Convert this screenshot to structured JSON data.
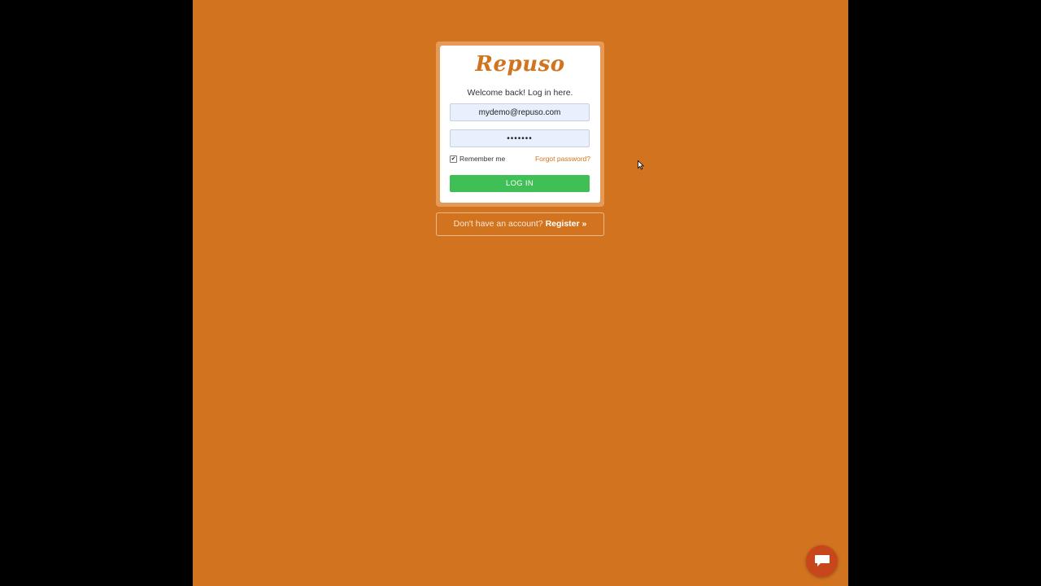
{
  "brand": {
    "logo_text": "Repuso",
    "accent_color": "#d2741f",
    "background_color": "#d2741f"
  },
  "login": {
    "welcome_text": "Welcome back! Log in here.",
    "email_value": "mydemo@repuso.com",
    "password_value": "•••••••",
    "remember_label": "Remember me",
    "remember_checked": true,
    "checkbox_mark": "✔",
    "forgot_label": "Forgot password?",
    "submit_label": "LOG IN",
    "submit_color": "#3fbf55"
  },
  "register": {
    "prompt_text": "Don't have an account? ",
    "link_label": "Register »"
  },
  "chat": {
    "icon": "chat-bubble-icon",
    "color": "#c8461c"
  }
}
